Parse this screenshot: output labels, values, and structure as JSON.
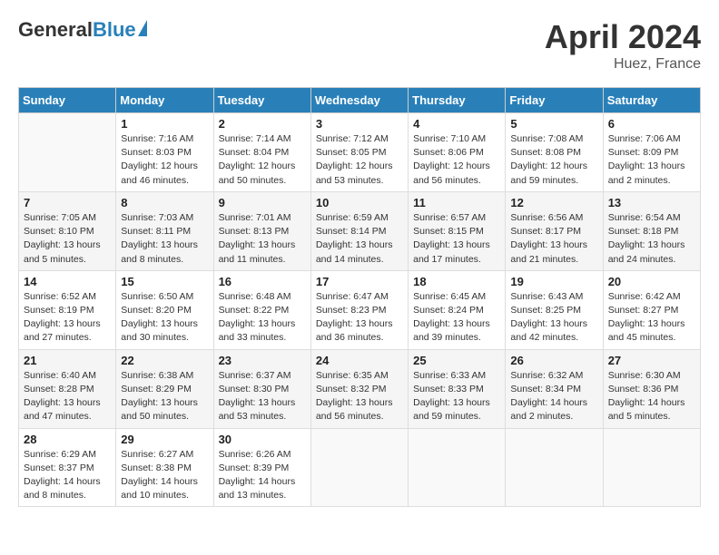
{
  "header": {
    "logo_general": "General",
    "logo_blue": "Blue",
    "month_title": "April 2024",
    "location": "Huez, France"
  },
  "days_of_week": [
    "Sunday",
    "Monday",
    "Tuesday",
    "Wednesday",
    "Thursday",
    "Friday",
    "Saturday"
  ],
  "weeks": [
    [
      {
        "num": "",
        "sunrise": "",
        "sunset": "",
        "daylight": "",
        "empty": true
      },
      {
        "num": "1",
        "sunrise": "Sunrise: 7:16 AM",
        "sunset": "Sunset: 8:03 PM",
        "daylight": "Daylight: 12 hours and 46 minutes."
      },
      {
        "num": "2",
        "sunrise": "Sunrise: 7:14 AM",
        "sunset": "Sunset: 8:04 PM",
        "daylight": "Daylight: 12 hours and 50 minutes."
      },
      {
        "num": "3",
        "sunrise": "Sunrise: 7:12 AM",
        "sunset": "Sunset: 8:05 PM",
        "daylight": "Daylight: 12 hours and 53 minutes."
      },
      {
        "num": "4",
        "sunrise": "Sunrise: 7:10 AM",
        "sunset": "Sunset: 8:06 PM",
        "daylight": "Daylight: 12 hours and 56 minutes."
      },
      {
        "num": "5",
        "sunrise": "Sunrise: 7:08 AM",
        "sunset": "Sunset: 8:08 PM",
        "daylight": "Daylight: 12 hours and 59 minutes."
      },
      {
        "num": "6",
        "sunrise": "Sunrise: 7:06 AM",
        "sunset": "Sunset: 8:09 PM",
        "daylight": "Daylight: 13 hours and 2 minutes."
      }
    ],
    [
      {
        "num": "7",
        "sunrise": "Sunrise: 7:05 AM",
        "sunset": "Sunset: 8:10 PM",
        "daylight": "Daylight: 13 hours and 5 minutes."
      },
      {
        "num": "8",
        "sunrise": "Sunrise: 7:03 AM",
        "sunset": "Sunset: 8:11 PM",
        "daylight": "Daylight: 13 hours and 8 minutes."
      },
      {
        "num": "9",
        "sunrise": "Sunrise: 7:01 AM",
        "sunset": "Sunset: 8:13 PM",
        "daylight": "Daylight: 13 hours and 11 minutes."
      },
      {
        "num": "10",
        "sunrise": "Sunrise: 6:59 AM",
        "sunset": "Sunset: 8:14 PM",
        "daylight": "Daylight: 13 hours and 14 minutes."
      },
      {
        "num": "11",
        "sunrise": "Sunrise: 6:57 AM",
        "sunset": "Sunset: 8:15 PM",
        "daylight": "Daylight: 13 hours and 17 minutes."
      },
      {
        "num": "12",
        "sunrise": "Sunrise: 6:56 AM",
        "sunset": "Sunset: 8:17 PM",
        "daylight": "Daylight: 13 hours and 21 minutes."
      },
      {
        "num": "13",
        "sunrise": "Sunrise: 6:54 AM",
        "sunset": "Sunset: 8:18 PM",
        "daylight": "Daylight: 13 hours and 24 minutes."
      }
    ],
    [
      {
        "num": "14",
        "sunrise": "Sunrise: 6:52 AM",
        "sunset": "Sunset: 8:19 PM",
        "daylight": "Daylight: 13 hours and 27 minutes."
      },
      {
        "num": "15",
        "sunrise": "Sunrise: 6:50 AM",
        "sunset": "Sunset: 8:20 PM",
        "daylight": "Daylight: 13 hours and 30 minutes."
      },
      {
        "num": "16",
        "sunrise": "Sunrise: 6:48 AM",
        "sunset": "Sunset: 8:22 PM",
        "daylight": "Daylight: 13 hours and 33 minutes."
      },
      {
        "num": "17",
        "sunrise": "Sunrise: 6:47 AM",
        "sunset": "Sunset: 8:23 PM",
        "daylight": "Daylight: 13 hours and 36 minutes."
      },
      {
        "num": "18",
        "sunrise": "Sunrise: 6:45 AM",
        "sunset": "Sunset: 8:24 PM",
        "daylight": "Daylight: 13 hours and 39 minutes."
      },
      {
        "num": "19",
        "sunrise": "Sunrise: 6:43 AM",
        "sunset": "Sunset: 8:25 PM",
        "daylight": "Daylight: 13 hours and 42 minutes."
      },
      {
        "num": "20",
        "sunrise": "Sunrise: 6:42 AM",
        "sunset": "Sunset: 8:27 PM",
        "daylight": "Daylight: 13 hours and 45 minutes."
      }
    ],
    [
      {
        "num": "21",
        "sunrise": "Sunrise: 6:40 AM",
        "sunset": "Sunset: 8:28 PM",
        "daylight": "Daylight: 13 hours and 47 minutes."
      },
      {
        "num": "22",
        "sunrise": "Sunrise: 6:38 AM",
        "sunset": "Sunset: 8:29 PM",
        "daylight": "Daylight: 13 hours and 50 minutes."
      },
      {
        "num": "23",
        "sunrise": "Sunrise: 6:37 AM",
        "sunset": "Sunset: 8:30 PM",
        "daylight": "Daylight: 13 hours and 53 minutes."
      },
      {
        "num": "24",
        "sunrise": "Sunrise: 6:35 AM",
        "sunset": "Sunset: 8:32 PM",
        "daylight": "Daylight: 13 hours and 56 minutes."
      },
      {
        "num": "25",
        "sunrise": "Sunrise: 6:33 AM",
        "sunset": "Sunset: 8:33 PM",
        "daylight": "Daylight: 13 hours and 59 minutes."
      },
      {
        "num": "26",
        "sunrise": "Sunrise: 6:32 AM",
        "sunset": "Sunset: 8:34 PM",
        "daylight": "Daylight: 14 hours and 2 minutes."
      },
      {
        "num": "27",
        "sunrise": "Sunrise: 6:30 AM",
        "sunset": "Sunset: 8:36 PM",
        "daylight": "Daylight: 14 hours and 5 minutes."
      }
    ],
    [
      {
        "num": "28",
        "sunrise": "Sunrise: 6:29 AM",
        "sunset": "Sunset: 8:37 PM",
        "daylight": "Daylight: 14 hours and 8 minutes."
      },
      {
        "num": "29",
        "sunrise": "Sunrise: 6:27 AM",
        "sunset": "Sunset: 8:38 PM",
        "daylight": "Daylight: 14 hours and 10 minutes."
      },
      {
        "num": "30",
        "sunrise": "Sunrise: 6:26 AM",
        "sunset": "Sunset: 8:39 PM",
        "daylight": "Daylight: 14 hours and 13 minutes."
      },
      {
        "num": "",
        "sunrise": "",
        "sunset": "",
        "daylight": "",
        "empty": true
      },
      {
        "num": "",
        "sunrise": "",
        "sunset": "",
        "daylight": "",
        "empty": true
      },
      {
        "num": "",
        "sunrise": "",
        "sunset": "",
        "daylight": "",
        "empty": true
      },
      {
        "num": "",
        "sunrise": "",
        "sunset": "",
        "daylight": "",
        "empty": true
      }
    ]
  ]
}
